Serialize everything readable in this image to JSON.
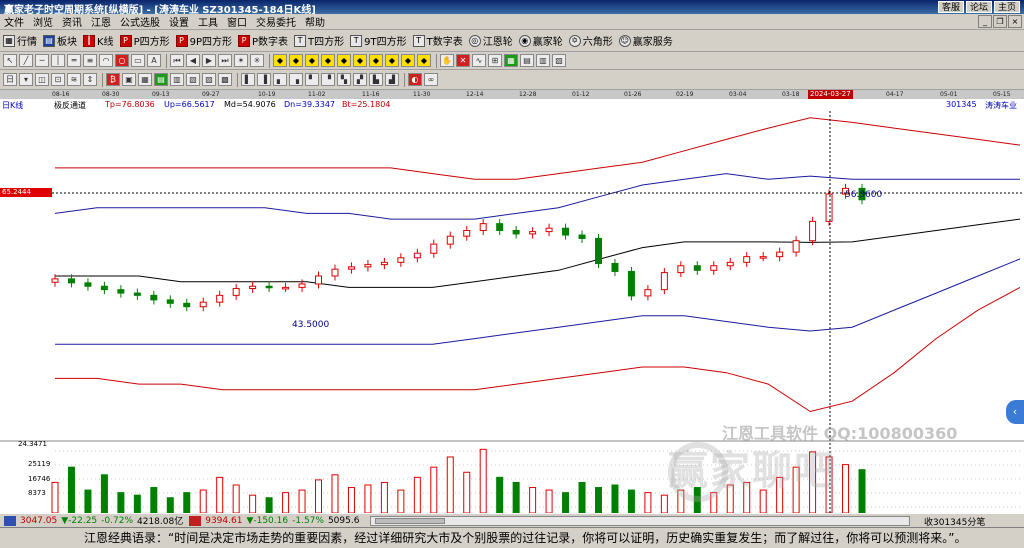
{
  "window": {
    "title": "赢家老子时空周期系统[纵横版] - [涛涛车业  SZ301345-184日K线]",
    "links": [
      "客服",
      "论坛",
      "主页"
    ]
  },
  "menu": [
    "文件",
    "浏览",
    "资讯",
    "江恩",
    "公式选股",
    "设置",
    "工具",
    "窗口",
    "交易委托",
    "帮助"
  ],
  "toolbar1": [
    {
      "icon": "grid-icon",
      "label": "行情"
    },
    {
      "icon": "blocks-icon",
      "label": "板块"
    },
    {
      "icon": "candle-icon",
      "label": "K线"
    },
    {
      "icon": "p-square-icon",
      "label": "P四方形"
    },
    {
      "icon": "9p-square-icon",
      "label": "9P四方形"
    },
    {
      "icon": "p-digit-icon",
      "label": "P数字表"
    },
    {
      "icon": "t-square-icon",
      "label": "T四方形"
    },
    {
      "icon": "9t-square-icon",
      "label": "9T四方形"
    },
    {
      "icon": "t-digit-icon",
      "label": "T数字表"
    },
    {
      "icon": "gann-wheel-icon",
      "label": "江恩轮"
    },
    {
      "icon": "winner-wheel-icon",
      "label": "赢家轮"
    },
    {
      "icon": "hexagon-icon",
      "label": "六角形"
    },
    {
      "icon": "service-icon",
      "label": "赢家服务"
    }
  ],
  "dates": [
    "08-16",
    "08-30",
    "09-13",
    "09-27",
    "10-19",
    "11-02",
    "11-16",
    "11-30",
    "12-14",
    "12-28",
    "01-12",
    "01-26",
    "02-19",
    "03-04",
    "03-18",
    "2024-03-27",
    "04-17",
    "05-01",
    "05-15"
  ],
  "info": {
    "period": "日K线",
    "indicator": "极反通道",
    "tp": "Tp=76.8036",
    "up": "Up=66.5617",
    "md": "Md=54.9076",
    "dn": "Dn=39.3347",
    "bt": "Bt=25.1804",
    "code": "301345",
    "name": "涛涛车业"
  },
  "price_label": "65.2444",
  "annotations": {
    "high": "56.3600",
    "low": "43.5000"
  },
  "volume_labels": [
    "24.3471",
    "25119",
    "16746",
    "8373"
  ],
  "watermark": {
    "line1": "江恩工具软件 QQ:100800360",
    "line2": "赢家聊吧"
  },
  "status": {
    "sh_index": "3047.05",
    "sh_change": "▼-22.25",
    "sh_pct": "-0.72%",
    "sh_amount": "4218.08亿",
    "sz_index": "9394.61",
    "sz_change": "▼-150.16",
    "sz_pct": "-1.57%",
    "sz_amount": "5095.6",
    "right": "收301345分笔"
  },
  "footer": "江恩经典语录：“时间是决定市场走势的重要因素，经过详细研究大市及个别股票的过往记录，你将可以证明，历史确实重复发生；而了解过往，你将可以预测将来。”。",
  "colors": {
    "up": "#e00000",
    "down": "#008000",
    "upper_band": "#cc0000",
    "mid_band": "#1a1aa0",
    "middle": "#000000"
  },
  "chart_data": {
    "type": "candlestick",
    "x_range": [
      "08-16",
      "05-15"
    ],
    "y_range": [
      25.18,
      76.8
    ],
    "bands": {
      "tp": [
        68,
        68,
        68,
        68,
        68,
        68,
        68,
        68,
        68,
        67,
        66,
        66,
        67,
        68,
        69,
        71,
        73,
        75,
        76.8,
        76,
        75,
        74,
        73,
        72
      ],
      "up": [
        60,
        61,
        61,
        61,
        61,
        61,
        60,
        60,
        59,
        59,
        59,
        60,
        61,
        63,
        65,
        66,
        67,
        66,
        66.56,
        66,
        66,
        66,
        66,
        66
      ],
      "md": [
        49,
        49,
        49,
        48,
        48,
        48,
        48,
        47,
        47,
        47,
        48,
        49,
        50,
        52,
        54,
        55,
        55,
        55,
        54.9,
        55,
        56,
        57,
        58,
        59
      ],
      "dn": [
        37,
        37,
        37,
        37,
        37,
        37,
        37,
        37,
        37,
        37,
        38,
        39,
        40,
        41,
        42,
        42,
        41,
        40,
        39.33,
        40,
        43,
        46,
        49,
        52
      ],
      "bt": [
        31,
        31,
        30,
        30,
        29,
        29,
        29,
        29,
        29,
        29,
        29,
        30,
        31,
        32,
        33,
        33,
        32,
        30,
        25.18,
        27,
        32,
        38,
        43,
        47
      ]
    },
    "candles_close": [
      48.5,
      47.8,
      47.2,
      46.6,
      46.0,
      45.6,
      44.8,
      44.2,
      43.6,
      44.4,
      45.6,
      46.8,
      47.2,
      47.0,
      47.0,
      47.6,
      49.0,
      50.2,
      50.6,
      51.0,
      51.4,
      52.2,
      53.0,
      54.6,
      56.0,
      57.0,
      58.2,
      57.0,
      56.4,
      56.8,
      57.4,
      56.2,
      55.6,
      51.2,
      49.8,
      45.5,
      46.6,
      49.6,
      50.8,
      50.0,
      50.8,
      51.4,
      52.4,
      52.4,
      53.2,
      55.2,
      58.6,
      63.4,
      64.4,
      62.4
    ],
    "volume_series": [
      12,
      18,
      9,
      15,
      8,
      7,
      10,
      6,
      8,
      9,
      14,
      11,
      7,
      6,
      8,
      9,
      13,
      15,
      10,
      11,
      12,
      9,
      14,
      18,
      22,
      16,
      25,
      14,
      12,
      10,
      9,
      8,
      12,
      10,
      11,
      9,
      8,
      7,
      9,
      10,
      8,
      11,
      12,
      9,
      14,
      18,
      24,
      22,
      19,
      17
    ],
    "ylim_volume": [
      0,
      24.3471
    ]
  }
}
